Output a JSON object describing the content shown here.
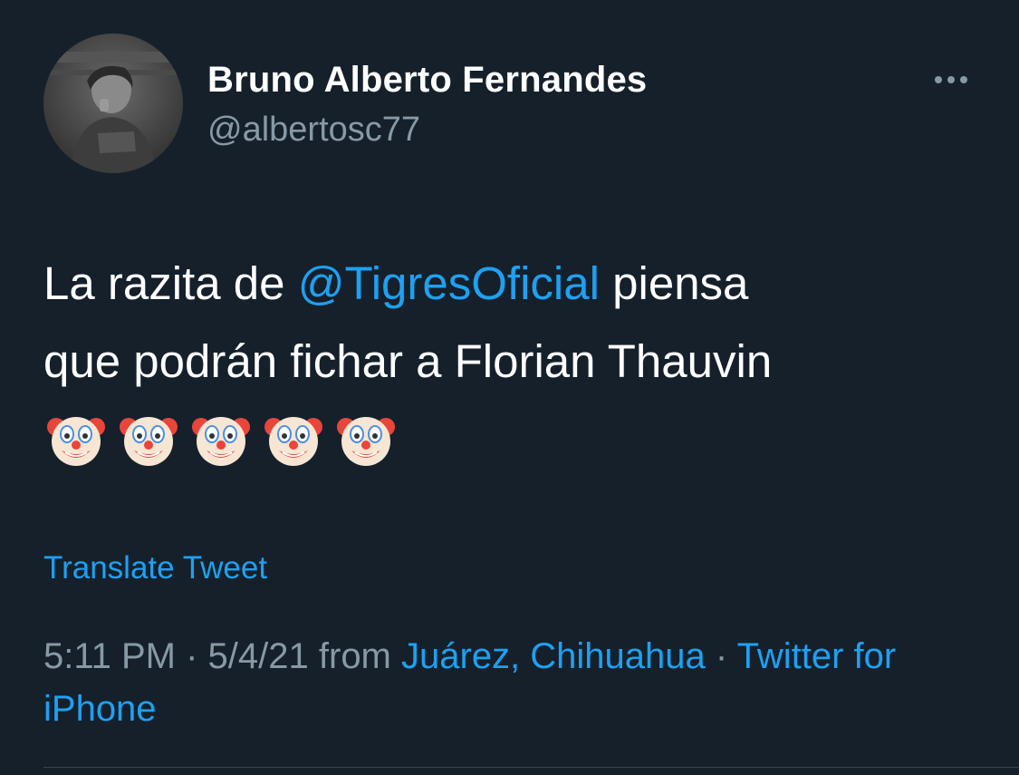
{
  "tweet": {
    "author": {
      "display_name": "Bruno Alberto Fernandes",
      "handle": "@albertosc77",
      "avatar_icon": "profile-photo"
    },
    "more_icon": "more-horizontal-icon",
    "text": {
      "line1_prefix": "La razita de ",
      "mention": "@TigresOficial",
      "line1_suffix": " piensa",
      "line2": "que podrán fichar a Florian Thauvin"
    },
    "emojis": [
      "clown-face-emoji",
      "clown-face-emoji",
      "clown-face-emoji",
      "clown-face-emoji",
      "clown-face-emoji"
    ],
    "translate_label": "Translate Tweet",
    "meta": {
      "time": "5:11 PM",
      "sep1": " · ",
      "date": "5/4/21",
      "from": " from ",
      "location": "Juárez, Chihuahua",
      "sep2": " · ",
      "source": "Twitter for iPhone"
    }
  },
  "colors": {
    "background": "#15202b",
    "primary_text": "#ffffff",
    "secondary_text": "#8899a6",
    "link": "#1da1f2",
    "divider": "#38444d"
  }
}
